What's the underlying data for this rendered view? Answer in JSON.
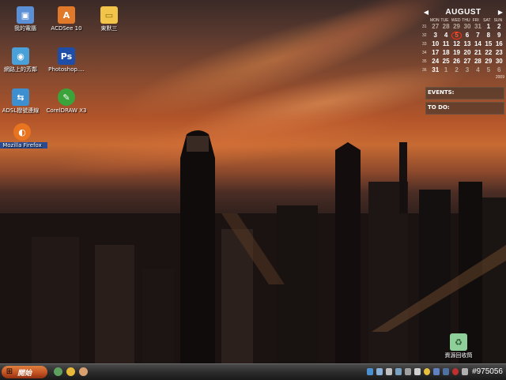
{
  "desktop_icons": [
    {
      "label": "我的電腦",
      "icon": "computer-icon",
      "color": "#5b8fd6"
    },
    {
      "label": "ACDSee 10",
      "icon": "acdsee-icon",
      "color": "#e07a2a"
    },
    {
      "label": "東默三",
      "icon": "folder-icon",
      "color": "#f2c44a"
    },
    {
      "label": "網路上的芳鄰",
      "icon": "network-icon",
      "color": "#4aa0d8"
    },
    {
      "label": "Photoshop....",
      "icon": "photoshop-icon",
      "color": "#1f4ea8"
    },
    {
      "label": "ADSL撥號連線",
      "icon": "adsl-connection-icon",
      "color": "#3d8fd0"
    },
    {
      "label": "CorelDRAW X3",
      "icon": "coreldraw-icon",
      "color": "#3aa33a"
    },
    {
      "label": "Mozilla Firefox",
      "icon": "firefox-icon",
      "color": "#e8741f"
    },
    {
      "label": "資源回收筒",
      "icon": "recycle-bin-icon",
      "color": "#8fcf9a"
    }
  ],
  "calendar": {
    "month": "AUGUST",
    "year": "2009",
    "weekdays": [
      "MON",
      "TUE",
      "WED",
      "THU",
      "FRI",
      "SAT",
      "SUN"
    ],
    "weeks": [
      {
        "num": "31",
        "days": [
          "27",
          "28",
          "29",
          "30",
          "31",
          "1",
          "2"
        ]
      },
      {
        "num": "32",
        "days": [
          "3",
          "4",
          "5",
          "6",
          "7",
          "8",
          "9"
        ]
      },
      {
        "num": "33",
        "days": [
          "10",
          "11",
          "12",
          "13",
          "14",
          "15",
          "16"
        ]
      },
      {
        "num": "34",
        "days": [
          "17",
          "18",
          "19",
          "20",
          "21",
          "22",
          "23"
        ]
      },
      {
        "num": "35",
        "days": [
          "24",
          "25",
          "26",
          "27",
          "28",
          "29",
          "30"
        ]
      },
      {
        "num": "36",
        "days": [
          "31",
          "1",
          "2",
          "3",
          "4",
          "5",
          "6"
        ]
      }
    ],
    "today": "5",
    "prev_symbol": "◀",
    "next_symbol": "▶"
  },
  "events_label": "EVENTS:",
  "todo_label": "TO DO:",
  "taskbar": {
    "start_label": "開始",
    "clock": "#975056"
  },
  "colors": {
    "accent": "#c76b33",
    "today_marker": "#ff3010"
  }
}
